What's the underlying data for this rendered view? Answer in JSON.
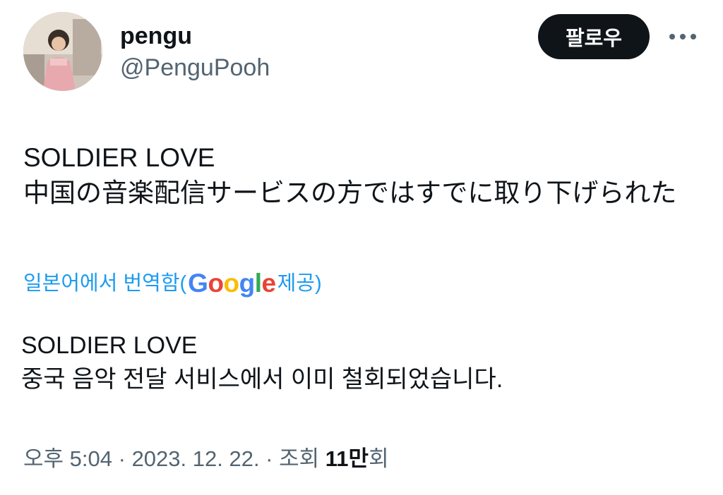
{
  "author": {
    "display_name": "pengu",
    "handle": "@PenguPooh"
  },
  "actions": {
    "follow_label": "팔로우",
    "more_icon": "more-horizontal-icon"
  },
  "tweet": {
    "lines": [
      "SOLDIER LOVE",
      "中国の音楽配信サービスの方ではすでに取り下げられた"
    ]
  },
  "translation": {
    "prefix": "일본어에서 번역함(",
    "provider_letters": [
      "G",
      "o",
      "o",
      "g",
      "l",
      "e"
    ],
    "suffix": " 제공)",
    "lines": [
      "SOLDIER LOVE",
      "중국 음악 전달 서비스에서 이미 철회되었습니다."
    ]
  },
  "meta": {
    "time": "오후 5:04",
    "separator": " · ",
    "date": "2023. 12. 22.",
    "separator2": " · ",
    "views_label": "조회 ",
    "views_count": "11만",
    "views_suffix": "회"
  },
  "colors": {
    "text": "#0f1419",
    "secondary": "#536471",
    "link": "#1d9bf0",
    "follow_bg": "#0f1419",
    "google_blue": "#4285f4",
    "google_red": "#ea4335",
    "google_yellow": "#fbbc05",
    "google_green": "#34a853"
  }
}
